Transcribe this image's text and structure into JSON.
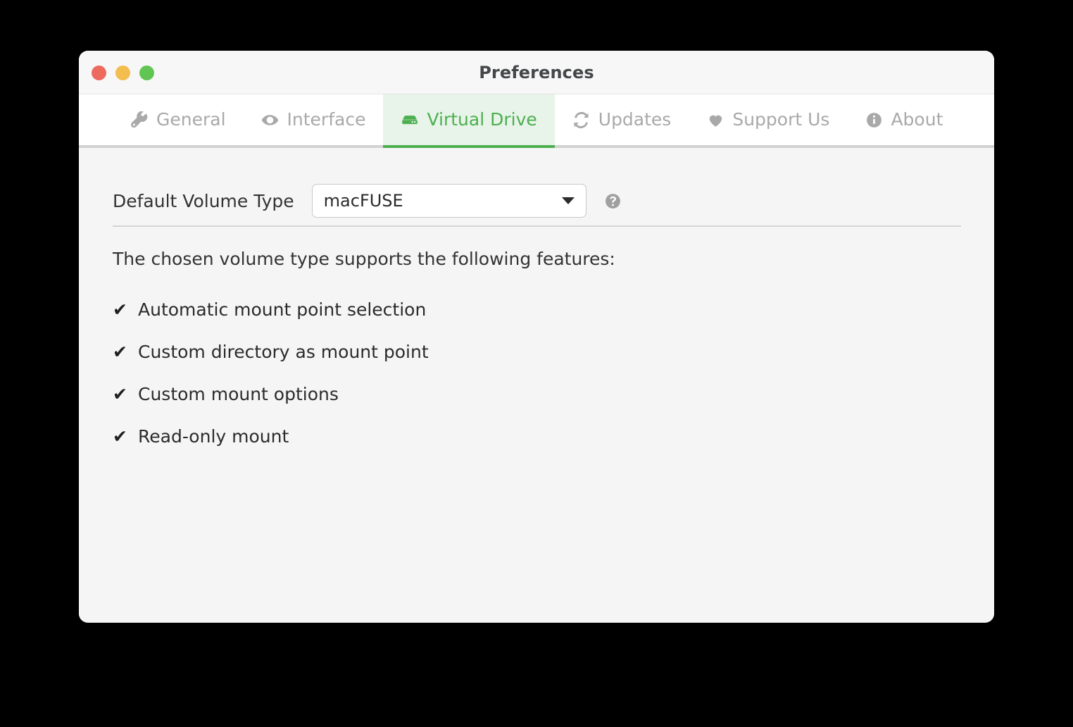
{
  "window": {
    "title": "Preferences",
    "traffic_lights": [
      {
        "name": "close",
        "color": "#ee6a5e"
      },
      {
        "name": "minimize",
        "color": "#f4bd4f"
      },
      {
        "name": "zoom",
        "color": "#61c554"
      }
    ]
  },
  "tabs": [
    {
      "id": "general",
      "label": "General",
      "icon": "wrench-icon",
      "active": false
    },
    {
      "id": "interface",
      "label": "Interface",
      "icon": "eye-icon",
      "active": false
    },
    {
      "id": "virtual-drive",
      "label": "Virtual Drive",
      "icon": "hard-drive-icon",
      "active": true
    },
    {
      "id": "updates",
      "label": "Updates",
      "icon": "refresh-icon",
      "active": false
    },
    {
      "id": "support-us",
      "label": "Support Us",
      "icon": "heart-icon",
      "active": false
    },
    {
      "id": "about",
      "label": "About",
      "icon": "info-circle-icon",
      "active": false
    }
  ],
  "main": {
    "volume_type": {
      "label": "Default Volume Type",
      "selected": "macFUSE",
      "help_icon": "question-circle-icon"
    },
    "features_intro": "The chosen volume type supports the following features:",
    "features": [
      {
        "mark": "✔",
        "label": "Automatic mount point selection"
      },
      {
        "mark": "✔",
        "label": "Custom directory as mount point"
      },
      {
        "mark": "✔",
        "label": "Custom mount options"
      },
      {
        "mark": "✔",
        "label": "Read-only mount"
      }
    ]
  },
  "colors": {
    "accent_green": "#4caf50",
    "active_tab_bg": "#e8f4e9",
    "inactive_tab_text": "#a9a9a9",
    "content_bg": "#f5f5f5",
    "titlebar_bg": "#f7f7f7",
    "tabbar_bg": "#ffffff",
    "tabbar_border": "#d2d2d2",
    "divider": "#d5d5d5",
    "desktop_bg": "#000000"
  }
}
